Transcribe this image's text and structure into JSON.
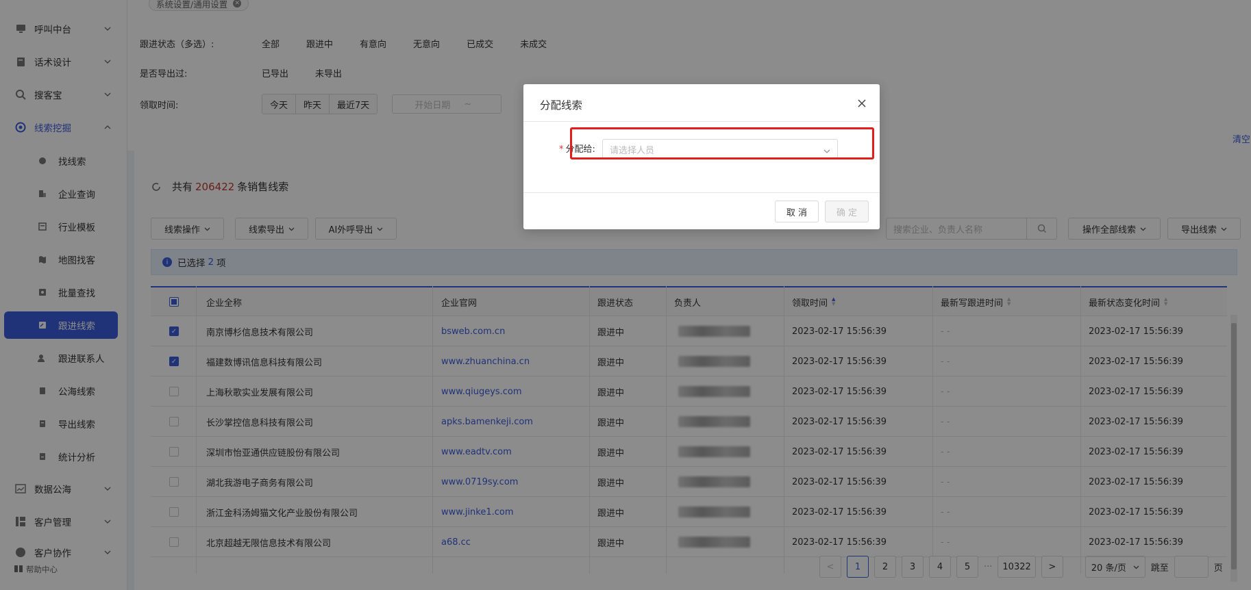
{
  "sidebar": {
    "items": [
      {
        "label": "呼叫中台",
        "icon": "monitor-icon"
      },
      {
        "label": "话术设计",
        "icon": "book-icon"
      },
      {
        "label": "搜客宝",
        "icon": "search-icon"
      },
      {
        "label": "线索挖掘",
        "icon": "target-icon"
      }
    ],
    "sub_items": [
      {
        "label": "找线索",
        "icon": "dot-icon"
      },
      {
        "label": "企业查询",
        "icon": "building-icon"
      },
      {
        "label": "行业模板",
        "icon": "template-icon"
      },
      {
        "label": "地图找客",
        "icon": "map-icon"
      },
      {
        "label": "批量查找",
        "icon": "batch-search-icon"
      },
      {
        "label": "跟进线索",
        "icon": "edit-icon"
      },
      {
        "label": "跟进联系人",
        "icon": "contact-icon"
      },
      {
        "label": "公海线索",
        "icon": "doc-icon"
      },
      {
        "label": "导出线索",
        "icon": "export-icon"
      },
      {
        "label": "统计分析",
        "icon": "stats-icon"
      }
    ],
    "bottom_items": [
      {
        "label": "数据公海",
        "icon": "chart-icon"
      },
      {
        "label": "客户管理",
        "icon": "customer-icon"
      },
      {
        "label": "客户协作",
        "icon": "collab-icon"
      }
    ],
    "help": "帮助中心"
  },
  "tabbar": {
    "tab_label": "系统设置/通用设置"
  },
  "filters": {
    "status_label": "跟进状态（多选）:",
    "status_options": [
      "全部",
      "跟进中",
      "有意向",
      "无意向",
      "已成交",
      "未成交"
    ],
    "export_label": "是否导出过:",
    "export_options": [
      "已导出",
      "未导出"
    ],
    "time_label": "领取时间:",
    "time_options": [
      "今天",
      "昨天",
      "最近7天"
    ],
    "start_date_placeholder": "开始日期",
    "tilde": "~",
    "clear": "清空"
  },
  "main": {
    "count_prefix": "共有",
    "count": "206422",
    "count_suffix": "条销售线索",
    "buttons": {
      "lead_ops": "线索操作",
      "lead_export": "线索导出",
      "ai_export": "AI外呼导出",
      "all_ops": "操作全部线索",
      "export_leads": "导出线索"
    },
    "search_placeholder": "搜索企业、负责人名称",
    "selected_prefix": "已选择",
    "selected_count": "2",
    "selected_suffix": "项"
  },
  "table": {
    "headers": {
      "company": "企业全称",
      "website": "企业官网",
      "status": "跟进状态",
      "owner": "负责人",
      "claim_time": "领取时间",
      "last_followup": "最新写跟进时间",
      "last_change": "最新状态变化时间"
    },
    "rows": [
      {
        "company": "南京博杉信息技术有限公司",
        "website": "bsweb.com.cn",
        "status": "跟进中",
        "claim": "2023-02-17 15:56:39",
        "followup": "- -",
        "change": "2023-02-17 15:56:39",
        "checked": true
      },
      {
        "company": "福建数博讯信息科技有限公司",
        "website": "www.zhuanchina.cn",
        "status": "跟进中",
        "claim": "2023-02-17 15:56:39",
        "followup": "- -",
        "change": "2023-02-17 15:56:39",
        "checked": true
      },
      {
        "company": "上海秋歌实业发展有限公司",
        "website": "www.qiugeys.com",
        "status": "跟进中",
        "claim": "2023-02-17 15:56:39",
        "followup": "- -",
        "change": "2023-02-17 15:56:39",
        "checked": false
      },
      {
        "company": "长沙掌控信息科技有限公司",
        "website": "apks.bamenkeji.com",
        "status": "跟进中",
        "claim": "2023-02-17 15:56:39",
        "followup": "- -",
        "change": "2023-02-17 15:56:39",
        "checked": false
      },
      {
        "company": "深圳市怡亚通供应链股份有限公司",
        "website": "www.eadtv.com",
        "status": "跟进中",
        "claim": "2023-02-17 15:56:39",
        "followup": "- -",
        "change": "2023-02-17 15:56:39",
        "checked": false
      },
      {
        "company": "湖北我游电子商务有限公司",
        "website": "www.0719sy.com",
        "status": "跟进中",
        "claim": "2023-02-17 15:56:39",
        "followup": "- -",
        "change": "2023-02-17 15:56:39",
        "checked": false
      },
      {
        "company": "浙江金科汤姆猫文化产业股份有限公司",
        "website": "www.jinke1.com",
        "status": "跟进中",
        "claim": "2023-02-17 15:56:39",
        "followup": "- -",
        "change": "2023-02-17 15:56:39",
        "checked": false
      },
      {
        "company": "北京超越无限信息技术有限公司",
        "website": "a68.cc",
        "status": "跟进中",
        "claim": "2023-02-17 15:56:39",
        "followup": "- -",
        "change": "2023-02-17 15:56:39",
        "checked": false
      }
    ]
  },
  "pagination": {
    "prev": "<",
    "pages": [
      "1",
      "2",
      "3",
      "4",
      "5"
    ],
    "ellipsis": "···",
    "last": "10322",
    "next": ">",
    "page_size": "20 条/页",
    "jump_label": "跳至",
    "page_unit": "页"
  },
  "modal": {
    "title": "分配线索",
    "field_label": "分配给:",
    "required_mark": "*",
    "select_placeholder": "请选择人员",
    "cancel": "取 消",
    "confirm": "确 定"
  },
  "colors": {
    "accent": "#3b5bdb",
    "highlight": "#e31c1c",
    "count": "#c0392b"
  }
}
